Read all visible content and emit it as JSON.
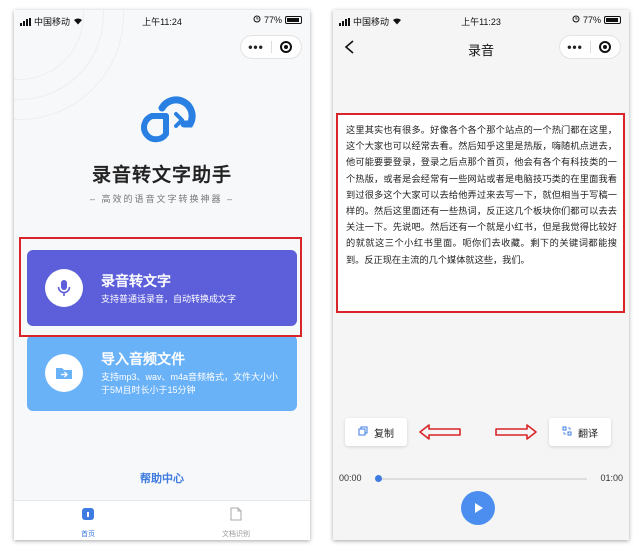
{
  "left_screen": {
    "status_bar": {
      "carrier": "中国移动",
      "time": "上午11:24",
      "battery": "77%"
    },
    "capsule": {
      "more_glyph": "•••"
    },
    "app_title": "录音转文字助手",
    "app_subtitle": "– 高效的语音文字转换神器 –",
    "cards": [
      {
        "title": "录音转文字",
        "description": "支持普通话录音，自动转换成文字",
        "color": "#5c5fd9",
        "icon": "microphone-icon"
      },
      {
        "title": "导入音频文件",
        "description": "支持mp3、wav、m4a音频格式，文件大小小于5M且时长小于15分钟",
        "color": "#6ab2f8",
        "icon": "folder-icon"
      }
    ],
    "help_link": "帮助中心",
    "tabbar": [
      {
        "label": "首页",
        "active": true,
        "icon": "home-icon"
      },
      {
        "label": "文档识别",
        "active": false,
        "icon": "document-icon"
      }
    ]
  },
  "right_screen": {
    "status_bar": {
      "carrier": "中国移动",
      "time": "上午11:23",
      "battery": "77%"
    },
    "capsule": {
      "more_glyph": "•••"
    },
    "nav_title": "录音",
    "transcript": "这里其实也有很多。好像各个各个那个站点的一个热门都在这里，这个大家也可以经常去看。然后知乎这里是热版，嗨随机点进去，他可能要要登录，登录之后点那个首页，他会有各个有科技类的一个热版，或者是会经常有一些网站或者是电脑技巧类的在里面我看到过很多这个大家可以去给他弄过来去写一下，就但相当于写稿一样的。然后这里面还有一些热词，反正这几个板块你们都可以去去关注一下。先说吧。然后还有一个就是小红书，但是我觉得比较好的就就这三个小红书里面。呃你们去收藏。剩下的关键词都能搜到。反正现在主流的几个媒体就这些，我们。",
    "copy_label": "复制",
    "translate_label": "翻译",
    "time_start": "00:00",
    "time_end": "01:00",
    "progress_fraction": 0.0
  },
  "colors": {
    "accent": "#3e7be0",
    "annotation_red": "#d9252a",
    "record_card": "#5c5fd9",
    "import_card": "#6ab2f8"
  }
}
